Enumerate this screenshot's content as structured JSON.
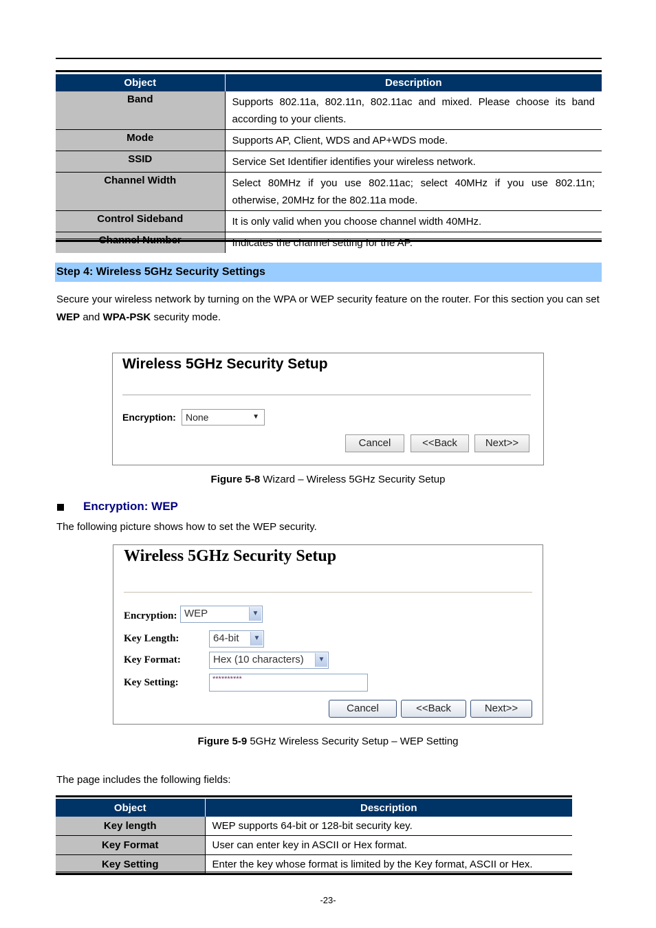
{
  "table1": {
    "headers": [
      "Object",
      "Description"
    ],
    "rows": [
      {
        "object": "Band",
        "description": "Supports 802.11a, 802.11n, 802.11ac and mixed. Please choose its band according to your clients."
      },
      {
        "object": "Mode",
        "description": "Supports AP, Client, WDS and AP+WDS mode."
      },
      {
        "object": "SSID",
        "description": "Service Set Identifier identifies your wireless network."
      },
      {
        "object": "Channel Width",
        "description": "Select 80MHz if you use 802.11ac; select 40MHz if you use 802.11n; otherwise, 20MHz for the 802.11a mode."
      },
      {
        "object": "Control Sideband",
        "description": "It is only valid when you choose channel width 40MHz."
      },
      {
        "object": "Channel Number",
        "description": "Indicates the channel setting for the AP."
      }
    ]
  },
  "step4": {
    "heading": "Step 4: Wireless 5GHz Security Settings",
    "intro_part1": "Secure your wireless network by turning on the WPA or WEP security feature on the router. For this section you can set ",
    "intro_bold1": "WEP",
    "intro_part2": " and ",
    "intro_bold2": "WPA-PSK",
    "intro_part3": " security mode."
  },
  "figure1": {
    "title": "Wireless 5GHz Security Setup",
    "encryption_label": "Encryption:",
    "encryption_value": "None",
    "buttons": {
      "cancel": "Cancel",
      "back": "<<Back",
      "next": "Next>>"
    },
    "caption_bold": "Figure 5-8",
    "caption_text": " Wizard – Wireless 5GHz Security Setup"
  },
  "wep_section": {
    "heading": "Encryption: WEP",
    "intro": "The following picture shows how to set the WEP security."
  },
  "figure2": {
    "title": "Wireless 5GHz Security Setup",
    "encryption_label": "Encryption:",
    "encryption_value": "WEP",
    "key_length_label": "Key Length:",
    "key_length_value": "64-bit",
    "key_format_label": "Key Format:",
    "key_format_value": "Hex (10 characters)",
    "key_setting_label": "Key Setting:",
    "key_setting_value": "**********",
    "buttons": {
      "cancel": "Cancel",
      "back": "<<Back",
      "next": "Next>>"
    },
    "caption_bold": "Figure 5-9",
    "caption_text": " 5GHz Wireless Security Setup – WEP Setting"
  },
  "fields_intro": "The page includes the following fields:",
  "table2": {
    "headers": [
      "Object",
      "Description"
    ],
    "rows": [
      {
        "object": "Key length",
        "description": "WEP supports 64-bit or 128-bit security key."
      },
      {
        "object": "Key Format",
        "description": "User can enter key in ASCII or Hex format."
      },
      {
        "object": "Key Setting",
        "description": "Enter the key whose format is limited by the Key format, ASCII or Hex."
      }
    ]
  },
  "page_number": "-23-",
  "colors": {
    "table_header": "#003366",
    "object_cell": "#c0c0c0",
    "step_bar": "#99ccff",
    "wep_heading": "#000080"
  }
}
